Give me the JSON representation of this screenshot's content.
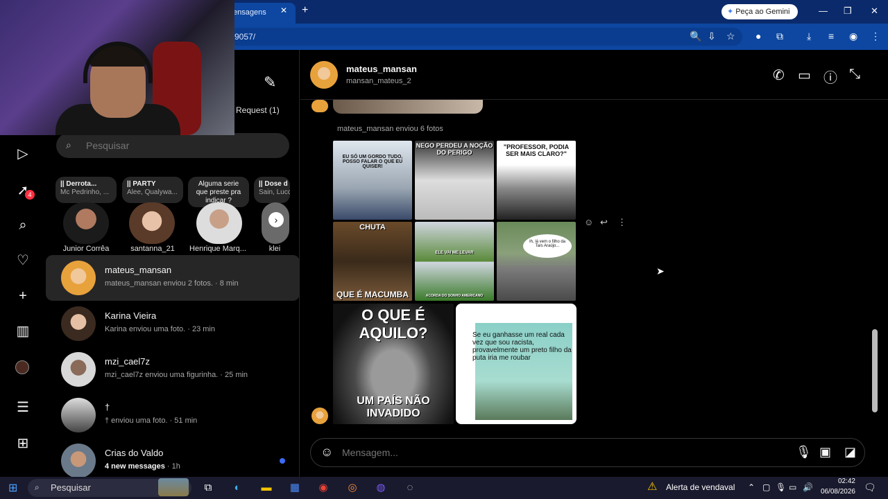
{
  "browser": {
    "tab_title": "ensagens",
    "tab_close": "✕",
    "new_tab": "+",
    "gemini_button": "Peça ao Gemini",
    "url": "9057/",
    "window_controls": [
      "—",
      "❐",
      "✕"
    ]
  },
  "nav": {
    "notification_count": "4",
    "icons": [
      "reels-icon",
      "messenger-icon",
      "search-icon",
      "heart-icon",
      "create-icon",
      "dashboard-icon",
      "profile-icon",
      "menu-icon",
      "apps-icon"
    ]
  },
  "inbox": {
    "request_label": "Request (1)",
    "search_placeholder": "Pesquisar",
    "notes": [
      {
        "title": "|| Derrota...",
        "sub": "Mc Pedrinho, ..."
      },
      {
        "title": "|| PARTY",
        "sub": "Alee, Qualywa..."
      },
      {
        "title": "Alguma serie que preste pra indicar ?",
        "sub": ""
      },
      {
        "title": "|| Dose d",
        "sub": "Sain, Lucc"
      }
    ],
    "stories": [
      "Junior Corrêa",
      "santanna_21",
      "Henrique Marq...",
      "klei"
    ],
    "threads": [
      {
        "name": "mateus_mansan",
        "sub": "mateus_mansan enviou 2 fotos. · 8 min"
      },
      {
        "name": "Karina Vieira",
        "sub": "Karina enviou uma foto. · 23 min"
      },
      {
        "name": "mzi_cael7z",
        "sub": "mzi_cael7z enviou uma figurinha. · 25 min"
      },
      {
        "name": "†",
        "sub": "† enviou uma foto. · 51 min"
      },
      {
        "name": "Crias do Valdo",
        "sub": "4 new messages",
        "time": " · 1h"
      }
    ]
  },
  "chat": {
    "title": "mateus_mansan",
    "subtitle": "mansan_mateus_2",
    "sent_label": "mateus_mansan enviou 6 fotos",
    "photos": [
      {
        "caption_top": "EU SÓ UM GORDO TUDO, POSSO FALAR O QUE EU QUISER!",
        "caption_bottom": ""
      },
      {
        "caption_top": "NEGO PERDEU A NOÇÃO DO PERIGO",
        "caption_bottom": ""
      },
      {
        "caption_top": "\"PROFESSOR, PODIA SER MAIS CLARO?\"",
        "caption_bottom": ""
      },
      {
        "caption_top": "CHUTA",
        "caption_bottom": "QUE É MACUMBA"
      },
      {
        "caption_top": "ELE VAI ME LEVAR",
        "caption_bottom": "ACORDA DO SONHO AMERICANO"
      },
      {
        "caption_top": "Ih, lá vem o filho da Taís Araújo...",
        "caption_bottom": ""
      },
      {
        "caption_top": "O QUE É AQUILO?",
        "caption_bottom": "UM PAÍS NÃO INVADIDO"
      },
      {
        "caption_top": "Se eu ganhasse um real cada vez que sou racista, provavelmente um preto filho da puta iria me roubar",
        "caption_bottom": ""
      }
    ],
    "composer_placeholder": "Mensagem..."
  },
  "taskbar": {
    "search_text": "Pesquisar",
    "alert_text": "Alerta de vendaval",
    "time": "02:42",
    "date": "06/08/2026"
  }
}
